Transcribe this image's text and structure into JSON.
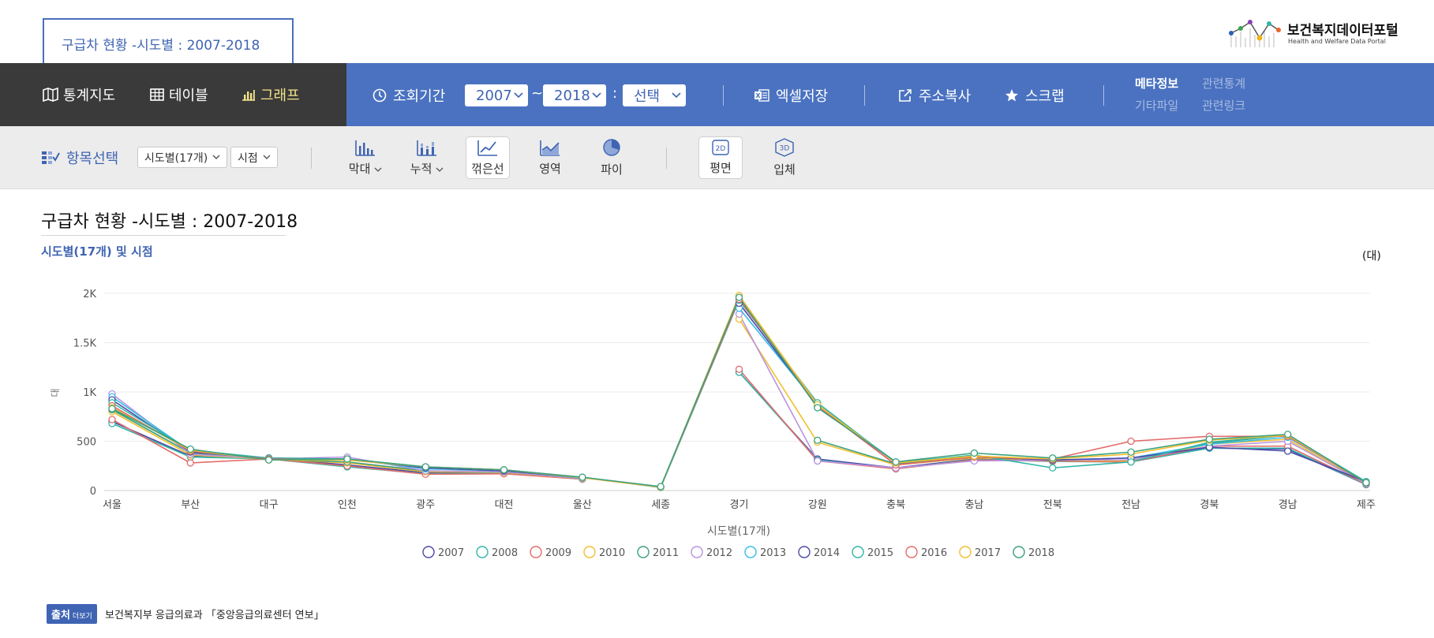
{
  "page": {
    "tab_title": "구급차 현황 -시도별 : 2007-2018",
    "logo_name": "보건복지데이터포털",
    "logo_en": "Health and Welfare Data Portal"
  },
  "nav": {
    "map": "통계지도",
    "table": "테이블",
    "graph": "그래프"
  },
  "period": {
    "label": "조회기간",
    "from": "2007",
    "tilde": "~",
    "to": "2018",
    "colon": ":",
    "choose": "선택"
  },
  "tools": {
    "excel": "엑셀저장",
    "copy_url": "주소복사",
    "scrap": "스크랩"
  },
  "meta_links": {
    "meta": "메타정보",
    "related_stats": "관련통계",
    "other_files": "기타파일",
    "related_links": "관련링크"
  },
  "options": {
    "item_select": "항목선택",
    "dim1": "시도별(17개)",
    "dim2": "시점"
  },
  "chart_types": {
    "bar": "막대",
    "stacked": "누적",
    "line": "꺾은선",
    "area": "영역",
    "pie": "파이",
    "flat": "평면",
    "threeD": "입체",
    "icon_2d": "2D",
    "icon_3d": "3D"
  },
  "chart_data": {
    "type": "line",
    "title": "구급차 현황 -시도별 : 2007-2018",
    "subtitle": "시도별(17개) 및 시점",
    "unit": "(대)",
    "xlabel": "시도별(17개)",
    "ylabel": "대",
    "ylim": [
      0,
      2000
    ],
    "yticks": [
      0,
      500,
      1000,
      1500,
      2000
    ],
    "ytick_labels": [
      "0",
      "500",
      "1K",
      "1.5K",
      "2K"
    ],
    "grid": true,
    "legend": "bottom",
    "categories": [
      "서울",
      "부산",
      "대구",
      "인천",
      "광주",
      "대전",
      "울산",
      "세종",
      "경기",
      "강원",
      "충북",
      "충남",
      "전북",
      "전남",
      "경북",
      "경남",
      "제주"
    ],
    "series": [
      {
        "name": "2007",
        "color": "#4a4aa6",
        "values": [
          700,
          350,
          330,
          260,
          180,
          180,
          120,
          null,
          1200,
          320,
          230,
          320,
          300,
          300,
          430,
          420,
          60
        ]
      },
      {
        "name": "2008",
        "color": "#2fb5a7",
        "values": [
          680,
          340,
          320,
          240,
          170,
          175,
          115,
          null,
          1200,
          310,
          220,
          315,
          295,
          290,
          430,
          430,
          60
        ]
      },
      {
        "name": "2009",
        "color": "#e46a6a",
        "values": [
          720,
          280,
          320,
          250,
          165,
          170,
          115,
          null,
          1230,
          300,
          220,
          310,
          300,
          290,
          450,
          450,
          65
        ]
      },
      {
        "name": "2010",
        "color": "#f2be2e",
        "values": [
          800,
          360,
          320,
          280,
          190,
          185,
          120,
          null,
          1740,
          490,
          260,
          330,
          310,
          300,
          470,
          520,
          70
        ]
      },
      {
        "name": "2011",
        "color": "#3aa07e",
        "values": [
          820,
          380,
          320,
          290,
          200,
          190,
          125,
          null,
          null,
          510,
          270,
          340,
          310,
          310,
          480,
          560,
          70
        ]
      },
      {
        "name": "2012",
        "color": "#b893e0",
        "values": [
          980,
          370,
          320,
          340,
          200,
          190,
          120,
          null,
          1790,
          300,
          230,
          300,
          310,
          310,
          450,
          500,
          70
        ]
      },
      {
        "name": "2013",
        "color": "#36bce8",
        "values": [
          950,
          400,
          320,
          320,
          220,
          200,
          125,
          null,
          1850,
          870,
          290,
          350,
          310,
          330,
          470,
          540,
          85
        ]
      },
      {
        "name": "2014",
        "color": "#4a4aa6",
        "values": [
          920,
          390,
          330,
          320,
          230,
          200,
          130,
          null,
          1900,
          860,
          260,
          340,
          310,
          330,
          440,
          400,
          90
        ]
      },
      {
        "name": "2015",
        "color": "#2fb5a7",
        "values": [
          890,
          410,
          330,
          320,
          240,
          210,
          135,
          30,
          1930,
          890,
          280,
          360,
          230,
          290,
          490,
          560,
          90
        ]
      },
      {
        "name": "2016",
        "color": "#e46a6a",
        "values": [
          860,
          400,
          320,
          310,
          240,
          210,
          130,
          35,
          1940,
          860,
          260,
          340,
          320,
          500,
          550,
          550,
          80
        ]
      },
      {
        "name": "2017",
        "color": "#f2be2e",
        "values": [
          840,
          410,
          310,
          310,
          240,
          210,
          130,
          35,
          1980,
          870,
          280,
          350,
          320,
          370,
          510,
          560,
          80
        ]
      },
      {
        "name": "2018",
        "color": "#3aa07e",
        "values": [
          830,
          420,
          310,
          320,
          240,
          210,
          135,
          40,
          1960,
          840,
          290,
          380,
          330,
          390,
          520,
          570,
          80
        ]
      }
    ]
  },
  "source": {
    "badge": "출처",
    "more": "더보기",
    "text": "보건복지부 응급의료과 「중앙응급의료센터 연보」"
  },
  "colors": {
    "dark_bar": "#3a3a3a",
    "blue_bar": "#4a72c0",
    "accent": "#3f64b3",
    "active_nav": "#f2e38a"
  }
}
